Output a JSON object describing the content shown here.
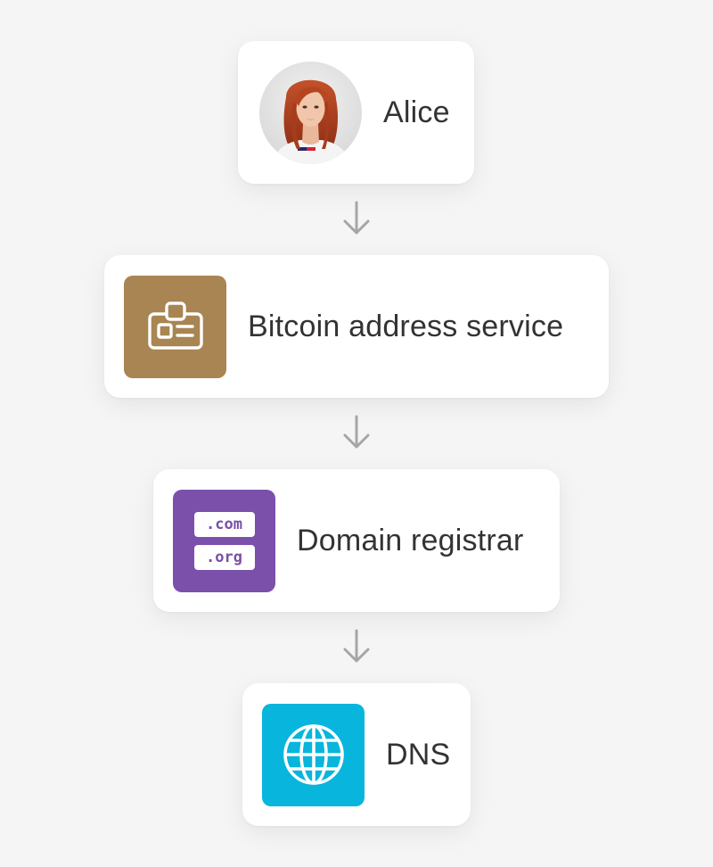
{
  "nodes": [
    {
      "label": "Alice",
      "icon": "alice-avatar"
    },
    {
      "label": "Bitcoin address service",
      "icon": "id-badge-icon",
      "color": "#a88552"
    },
    {
      "label": "Domain registrar",
      "icon": "domain-extensions-icon",
      "color": "#7b50ab",
      "chips": [
        ".com",
        ".org"
      ]
    },
    {
      "label": "DNS",
      "icon": "globe-icon",
      "color": "#08b5dd"
    }
  ],
  "edges": [
    {
      "from": "Alice",
      "to": "Bitcoin address service"
    },
    {
      "from": "Bitcoin address service",
      "to": "Domain registrar"
    },
    {
      "from": "Domain registrar",
      "to": "DNS"
    }
  ],
  "colors": {
    "background": "#f5f5f5",
    "card": "#ffffff",
    "text": "#333333",
    "arrow": "#a6a6a6"
  }
}
